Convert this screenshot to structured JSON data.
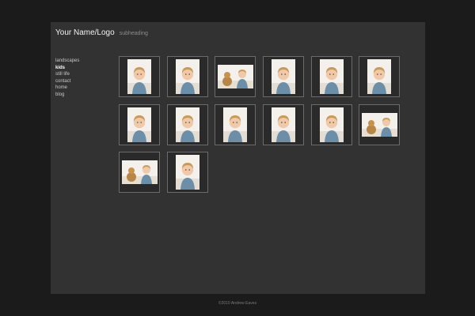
{
  "header": {
    "title": "Your Name/Logo",
    "subheading": "subheading"
  },
  "nav": {
    "items": [
      {
        "label": "landscapes",
        "active": false
      },
      {
        "label": "kids",
        "active": true
      },
      {
        "label": "still life",
        "active": false
      },
      {
        "label": "contact",
        "active": false
      },
      {
        "label": "home",
        "active": false
      },
      {
        "label": "blog",
        "active": false
      }
    ]
  },
  "gallery": {
    "thumbnails": [
      {
        "orientation": "portrait",
        "icon": "child-photo-icon"
      },
      {
        "orientation": "portrait",
        "icon": "child-photo-icon"
      },
      {
        "orientation": "landscape",
        "icon": "child-with-teddy-bear-photo-icon"
      },
      {
        "orientation": "portrait",
        "icon": "child-photo-icon"
      },
      {
        "orientation": "portrait",
        "icon": "child-in-box-photo-icon"
      },
      {
        "orientation": "portrait",
        "icon": "child-photo-icon"
      },
      {
        "orientation": "portrait",
        "icon": "child-photo-icon"
      },
      {
        "orientation": "portrait",
        "icon": "child-photo-icon"
      },
      {
        "orientation": "portrait",
        "icon": "cardboard-box-photo-icon"
      },
      {
        "orientation": "portrait",
        "icon": "child-eating-photo-icon"
      },
      {
        "orientation": "portrait",
        "icon": "child-eating-photo-icon"
      },
      {
        "orientation": "landscape",
        "icon": "child-photo-icon"
      },
      {
        "orientation": "landscape",
        "icon": "child-photo-icon"
      },
      {
        "orientation": "portrait",
        "icon": "child-photo-icon"
      }
    ]
  },
  "footer": {
    "text": "©2010 Andrew Eaves"
  },
  "colors": {
    "background": "#1b1b1b",
    "panel": "#323232",
    "thumb_border": "#6b6b6b"
  }
}
